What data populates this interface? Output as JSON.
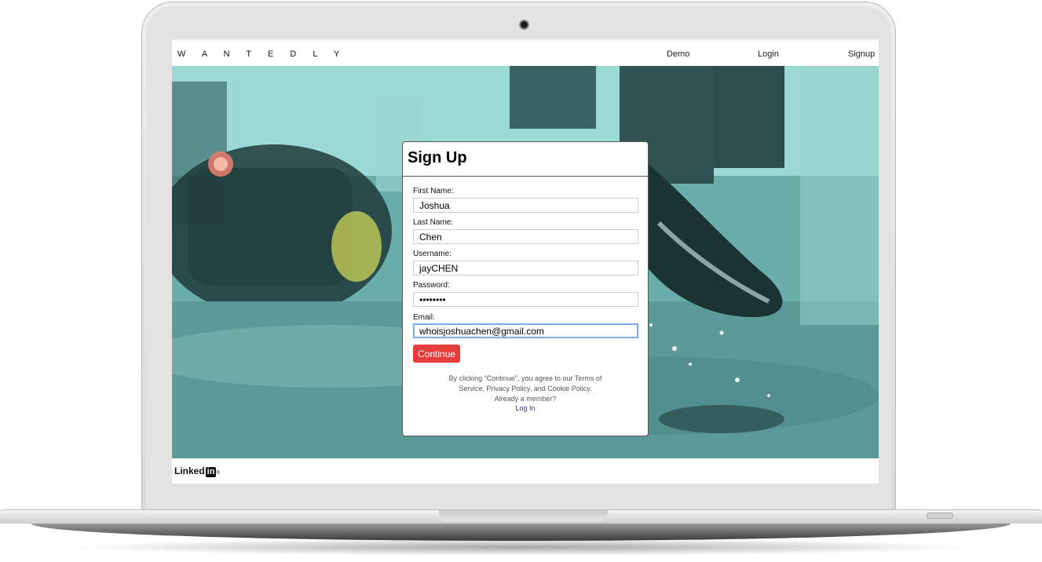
{
  "nav": {
    "brand": "W A N T E D L Y",
    "links": [
      "Demo",
      "Login",
      "Signup"
    ]
  },
  "signup": {
    "title": "Sign Up",
    "fields": [
      {
        "label": "First Name:",
        "value": "Joshua"
      },
      {
        "label": "Last Name:",
        "value": "Chen"
      },
      {
        "label": "Username:",
        "value": "jayCHEN"
      },
      {
        "label": "Password:",
        "value": "••••••••"
      },
      {
        "label": "Email:",
        "value": "whoisjoshuachen@gmail.com"
      }
    ],
    "continue_label": "Continue",
    "terms_line1": "By clicking \"Continue\", you agree to our Terms of",
    "terms_line2": "Service, Privacy Policy, and Cookie Policy.",
    "member_prompt": "Already a member?",
    "login_link": "Log In"
  },
  "footer": {
    "logo_text": "Linked",
    "logo_box": "in",
    "logo_mark": "®"
  },
  "colors": {
    "accent_red": "#e63c3c",
    "hero_teal": "#5fa3a0",
    "focus_blue": "#7aaef0",
    "link_purple": "#3a2a8a"
  },
  "icons": {
    "camera": "camera-dot",
    "hero": "sneaker-splash-photo"
  }
}
